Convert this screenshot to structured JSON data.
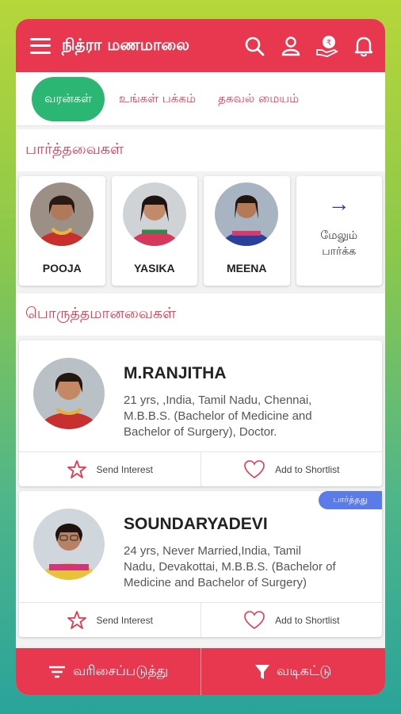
{
  "app": {
    "title": "நித்ரா மணமாலை"
  },
  "header_icons": [
    "search-icon",
    "user-icon",
    "payment-hand-icon",
    "bell-icon"
  ],
  "tabs": [
    {
      "label": "வரன்கள்",
      "active": true
    },
    {
      "label": "உங்கள் பக்கம்",
      "active": false
    },
    {
      "label": "தகவல் மையம்",
      "active": false
    }
  ],
  "viewed": {
    "title": "பார்த்தவைகள்",
    "profiles": [
      {
        "name": "POOJA"
      },
      {
        "name": "YASIKA"
      },
      {
        "name": "MEENA"
      }
    ],
    "more_label_line1": "மேலும்",
    "more_label_line2": "பார்க்க"
  },
  "matches": {
    "title": "பொருத்தமானவைகள்",
    "items": [
      {
        "name": "M.RANJITHA",
        "line1": "21 yrs, ,India, Tamil Nadu, Chennai,",
        "line2": "M.B.B.S. (Bachelor of Medicine and",
        "line3": "Bachelor of  Surgery), Doctor.",
        "badge": "",
        "send_interest": "Send Interest",
        "shortlist": "Add to Shortlist"
      },
      {
        "name": "SOUNDARYADEVI",
        "line1": "24 yrs, Never Married,India, Tamil",
        "line2": "Nadu, Devakottai, M.B.B.S. (Bachelor of",
        "line3": "Medicine and Bachelor of  Surgery)",
        "badge": "பார்த்தது",
        "send_interest": "Send Interest",
        "shortlist": "Add to Shortlist"
      }
    ]
  },
  "bottom": {
    "sort_label": "வரிசைப்படுத்து",
    "filter_label": "வடிகட்டு"
  },
  "colors": {
    "primary": "#e8384f",
    "active_tab": "#2bb673",
    "badge": "#5a7be8"
  }
}
